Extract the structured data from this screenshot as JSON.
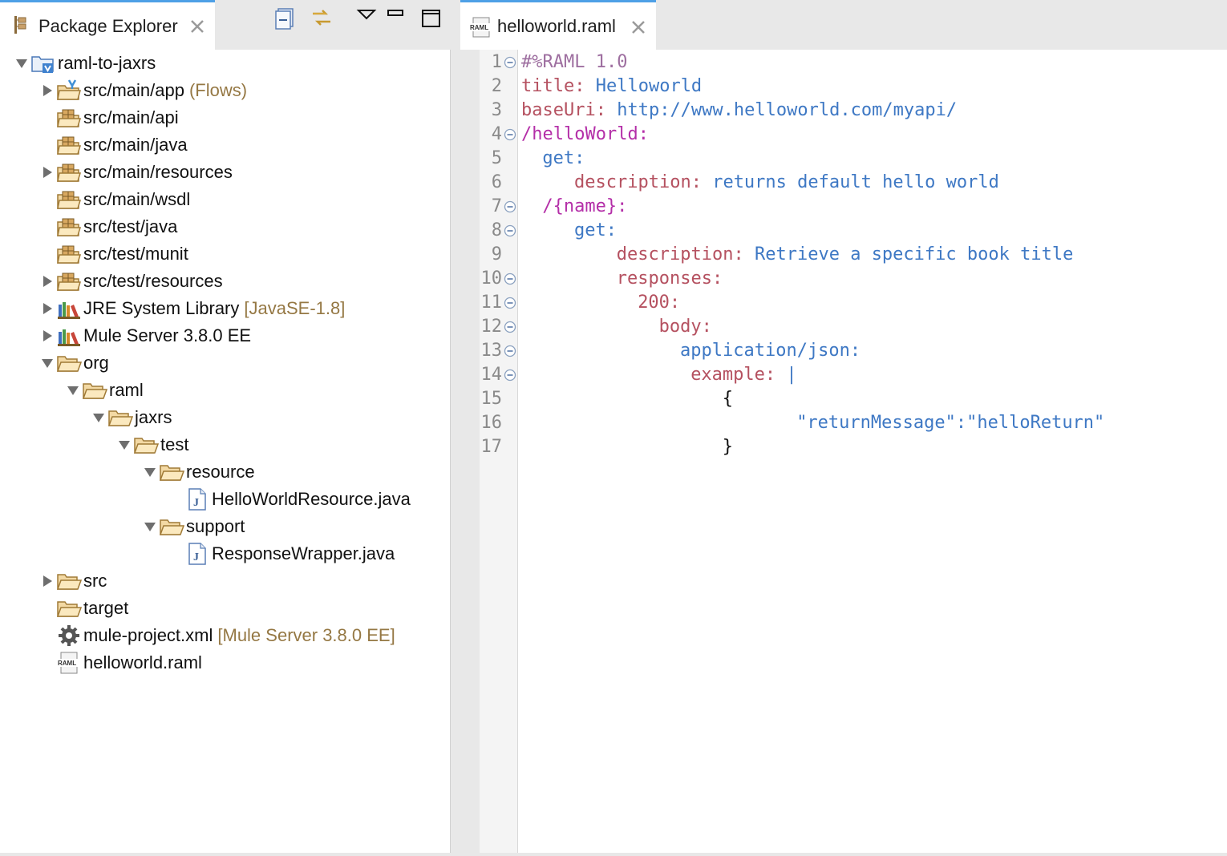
{
  "explorer": {
    "tab_title": "Package Explorer",
    "toolbar": [
      "collapse-all-icon",
      "link-with-editor-icon",
      "view-menu-icon",
      "minimize-icon",
      "maximize-icon"
    ],
    "tree": [
      {
        "label": "raml-to-jaxrs",
        "decor": "",
        "level": 0,
        "twisty": "expanded",
        "icon": "project-icon"
      },
      {
        "label": "src/main/app",
        "decor": "(Flows)",
        "level": 1,
        "twisty": "collapsed",
        "icon": "flows-folder-icon"
      },
      {
        "label": "src/main/api",
        "decor": "",
        "level": 1,
        "twisty": "none",
        "icon": "source-folder-icon"
      },
      {
        "label": "src/main/java",
        "decor": "",
        "level": 1,
        "twisty": "none",
        "icon": "source-folder-icon"
      },
      {
        "label": "src/main/resources",
        "decor": "",
        "level": 1,
        "twisty": "collapsed",
        "icon": "source-folder-icon"
      },
      {
        "label": "src/main/wsdl",
        "decor": "",
        "level": 1,
        "twisty": "none",
        "icon": "source-folder-icon"
      },
      {
        "label": "src/test/java",
        "decor": "",
        "level": 1,
        "twisty": "none",
        "icon": "source-folder-icon"
      },
      {
        "label": "src/test/munit",
        "decor": "",
        "level": 1,
        "twisty": "none",
        "icon": "source-folder-icon"
      },
      {
        "label": "src/test/resources",
        "decor": "",
        "level": 1,
        "twisty": "collapsed",
        "icon": "source-folder-icon"
      },
      {
        "label": "JRE System Library",
        "decor": "[JavaSE-1.8]",
        "level": 1,
        "twisty": "collapsed",
        "icon": "library-icon"
      },
      {
        "label": "Mule Server 3.8.0 EE",
        "decor": "",
        "level": 1,
        "twisty": "collapsed",
        "icon": "library-icon"
      },
      {
        "label": "org",
        "decor": "",
        "level": 1,
        "twisty": "expanded",
        "icon": "folder-open-icon"
      },
      {
        "label": "raml",
        "decor": "",
        "level": 2,
        "twisty": "expanded",
        "icon": "folder-open-icon"
      },
      {
        "label": "jaxrs",
        "decor": "",
        "level": 3,
        "twisty": "expanded",
        "icon": "folder-open-icon"
      },
      {
        "label": "test",
        "decor": "",
        "level": 4,
        "twisty": "expanded",
        "icon": "folder-open-icon"
      },
      {
        "label": "resource",
        "decor": "",
        "level": 5,
        "twisty": "expanded",
        "icon": "folder-open-icon"
      },
      {
        "label": "HelloWorldResource.java",
        "decor": "",
        "level": 6,
        "twisty": "none",
        "icon": "java-file-icon"
      },
      {
        "label": "support",
        "decor": "",
        "level": 5,
        "twisty": "expanded",
        "icon": "folder-open-icon"
      },
      {
        "label": "ResponseWrapper.java",
        "decor": "",
        "level": 6,
        "twisty": "none",
        "icon": "java-file-icon"
      },
      {
        "label": "src",
        "decor": "",
        "level": 1,
        "twisty": "collapsed",
        "icon": "folder-icon"
      },
      {
        "label": "target",
        "decor": "",
        "level": 1,
        "twisty": "none",
        "icon": "folder-icon"
      },
      {
        "label": "mule-project.xml",
        "decor": "[Mule Server 3.8.0 EE]",
        "level": 1,
        "twisty": "none",
        "icon": "gear-icon"
      },
      {
        "label": "helloworld.raml",
        "decor": "",
        "level": 1,
        "twisty": "none",
        "icon": "raml-file-icon"
      }
    ]
  },
  "editor": {
    "tab_title": "helloworld.raml",
    "lines": [
      {
        "n": "1",
        "fold": true,
        "indent": 0,
        "tokens": [
          {
            "t": "#%RAML 1.0",
            "c": "comment"
          }
        ]
      },
      {
        "n": "2",
        "fold": false,
        "indent": 0,
        "tokens": [
          {
            "t": "title:",
            "c": "key"
          },
          {
            "t": " Helloworld",
            "c": "val"
          }
        ]
      },
      {
        "n": "3",
        "fold": false,
        "indent": 0,
        "tokens": [
          {
            "t": "baseUri:",
            "c": "key"
          },
          {
            "t": " http://www.helloworld.com/myapi/",
            "c": "val"
          }
        ]
      },
      {
        "n": "4",
        "fold": true,
        "indent": 0,
        "tokens": [
          {
            "t": "/helloWorld:",
            "c": "res"
          }
        ]
      },
      {
        "n": "5",
        "fold": false,
        "indent": 2,
        "tokens": [
          {
            "t": "get:",
            "c": "val"
          }
        ]
      },
      {
        "n": "6",
        "fold": false,
        "indent": 5,
        "tokens": [
          {
            "t": "description:",
            "c": "key"
          },
          {
            "t": " returns default hello world",
            "c": "val"
          }
        ]
      },
      {
        "n": "7",
        "fold": true,
        "indent": 2,
        "tokens": [
          {
            "t": "/{name}:",
            "c": "res"
          }
        ]
      },
      {
        "n": "8",
        "fold": true,
        "indent": 5,
        "tokens": [
          {
            "t": "get:",
            "c": "val"
          }
        ]
      },
      {
        "n": "9",
        "fold": false,
        "indent": 9,
        "tokens": [
          {
            "t": "description:",
            "c": "key"
          },
          {
            "t": " Retrieve a specific book title",
            "c": "val"
          }
        ]
      },
      {
        "n": "10",
        "fold": true,
        "indent": 9,
        "tokens": [
          {
            "t": "responses:",
            "c": "key"
          }
        ]
      },
      {
        "n": "11",
        "fold": true,
        "indent": 11,
        "tokens": [
          {
            "t": "200:",
            "c": "key"
          }
        ]
      },
      {
        "n": "12",
        "fold": true,
        "indent": 13,
        "tokens": [
          {
            "t": "body:",
            "c": "key"
          }
        ]
      },
      {
        "n": "13",
        "fold": true,
        "indent": 15,
        "tokens": [
          {
            "t": "application/json:",
            "c": "val"
          }
        ]
      },
      {
        "n": "14",
        "fold": true,
        "indent": 16,
        "tokens": [
          {
            "t": "example:",
            "c": "key"
          },
          {
            "t": " |",
            "c": "val"
          }
        ]
      },
      {
        "n": "15",
        "fold": false,
        "indent": 19,
        "tokens": [
          {
            "t": "{",
            "c": "plain"
          }
        ]
      },
      {
        "n": "16",
        "fold": false,
        "indent": 26,
        "tokens": [
          {
            "t": "\"returnMessage\":\"helloReturn\"",
            "c": "str"
          }
        ]
      },
      {
        "n": "17",
        "fold": false,
        "indent": 19,
        "tokens": [
          {
            "t": "}",
            "c": "plain"
          }
        ]
      }
    ]
  },
  "colors": {
    "tab_accent": "#4ea0e6",
    "decoration": "#957844",
    "raml_key": "#b55160",
    "raml_value": "#3e78c4",
    "raml_resource": "#b42fa8",
    "raml_comment": "#9e6fa0"
  }
}
